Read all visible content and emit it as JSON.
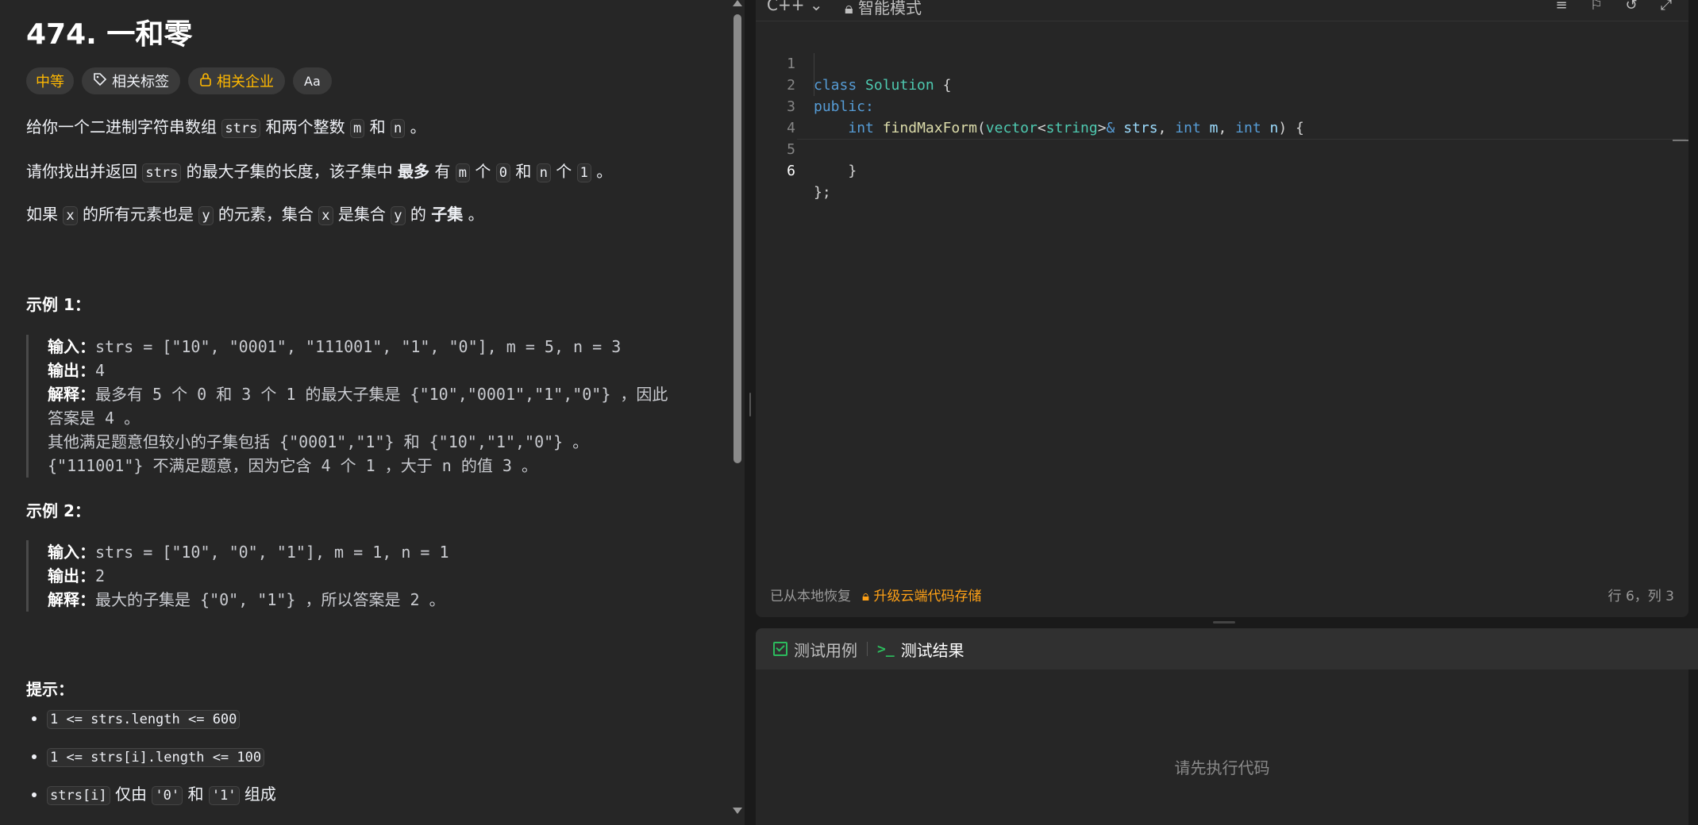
{
  "problem": {
    "title": "474. 一和零",
    "difficulty": "中等",
    "tags_label": "相关标签",
    "company_label": "相关企业",
    "font_icon": "Aa",
    "desc1": {
      "a": "给你一个二进制字符串数组 ",
      "c1": "strs",
      "b": " 和两个整数 ",
      "c2": "m",
      "c": " 和 ",
      "c3": "n",
      "d": " 。"
    },
    "desc2": {
      "a": "请你找出并返回 ",
      "c1": "strs",
      "b": " 的最大子集的长度，该子集中 ",
      "bold": "最多",
      "c": " 有 ",
      "c2": "m",
      "d": " 个 ",
      "c3": "0",
      "e": " 和 ",
      "c4": "n",
      "f": " 个 ",
      "c5": "1",
      "g": " 。"
    },
    "desc3": {
      "a": "如果 ",
      "c1": "x",
      "b": " 的所有元素也是 ",
      "c2": "y",
      "c": " 的元素，集合 ",
      "c3": "x",
      "d": " 是集合 ",
      "c4": "y",
      "e": " 的 ",
      "bold": "子集",
      "f": " 。"
    },
    "example1": {
      "title": "示例 1：",
      "input_label": "输入：",
      "input": "strs = [\"10\", \"0001\", \"111001\", \"1\", \"0\"], m = 5, n = 3",
      "output_label": "输出：",
      "output": "4",
      "explain_label": "解释：",
      "explain1": "最多有 5 个 0 和 3 个 1 的最大子集是 {\"10\",\"0001\",\"1\",\"0\"} ，因此",
      "explain2": "答案是 4 。",
      "explain3": "其他满足题意但较小的子集包括 {\"0001\",\"1\"} 和 {\"10\",\"1\",\"0\"} 。",
      "explain4": "{\"111001\"} 不满足题意，因为它含 4 个 1 ，大于 n 的值 3 。"
    },
    "example2": {
      "title": "示例 2：",
      "input_label": "输入：",
      "input": "strs = [\"10\", \"0\", \"1\"], m = 1, n = 1",
      "output_label": "输出：",
      "output": "2",
      "explain_label": "解释：",
      "explain1": "最大的子集是 {\"0\", \"1\"} ，所以答案是 2 。"
    },
    "hints_title": "提示：",
    "hints": [
      "1 <= strs.length <= 600",
      "1 <= strs[i].length <= 100"
    ],
    "hint3": {
      "c1": "strs[i]",
      "a": " 仅由 ",
      "c2": "'0'",
      "b": " 和 ",
      "c3": "'1'",
      "c": " 组成"
    }
  },
  "editor": {
    "language": "C++",
    "mode": "智能模式",
    "line_numbers": [
      "1",
      "2",
      "3",
      "4",
      "5",
      "6"
    ],
    "code": {
      "l1_kw": "class",
      "l1_ty": "Solution",
      "l1_p": " {",
      "l2": "public:",
      "l3_kw": "int",
      "l3_fn": "findMaxForm",
      "l3_p1": "(",
      "l3_t1": "vector",
      "l3_p2": "<",
      "l3_t2": "string",
      "l3_p3": ">",
      "l3_amp": "&",
      "l3_v1": "strs",
      "l3_c1": ", ",
      "l3_kw2": "int",
      "l3_v2": "m",
      "l3_c2": ", ",
      "l3_kw3": "int",
      "l3_v3": "n",
      "l3_end": ") {",
      "l5": "}",
      "l6": "};"
    },
    "status_restore": "已从本地恢复",
    "status_upgrade": "升级云端代码存储",
    "cursor_pos": "行 6，列 3"
  },
  "results": {
    "tab_testcase": "测试用例",
    "tab_result": "测试结果",
    "empty_message": "请先执行代码"
  },
  "colors": {
    "accent": "#ffa116",
    "difficulty": "#ffb800",
    "success": "#2cbb5d"
  }
}
